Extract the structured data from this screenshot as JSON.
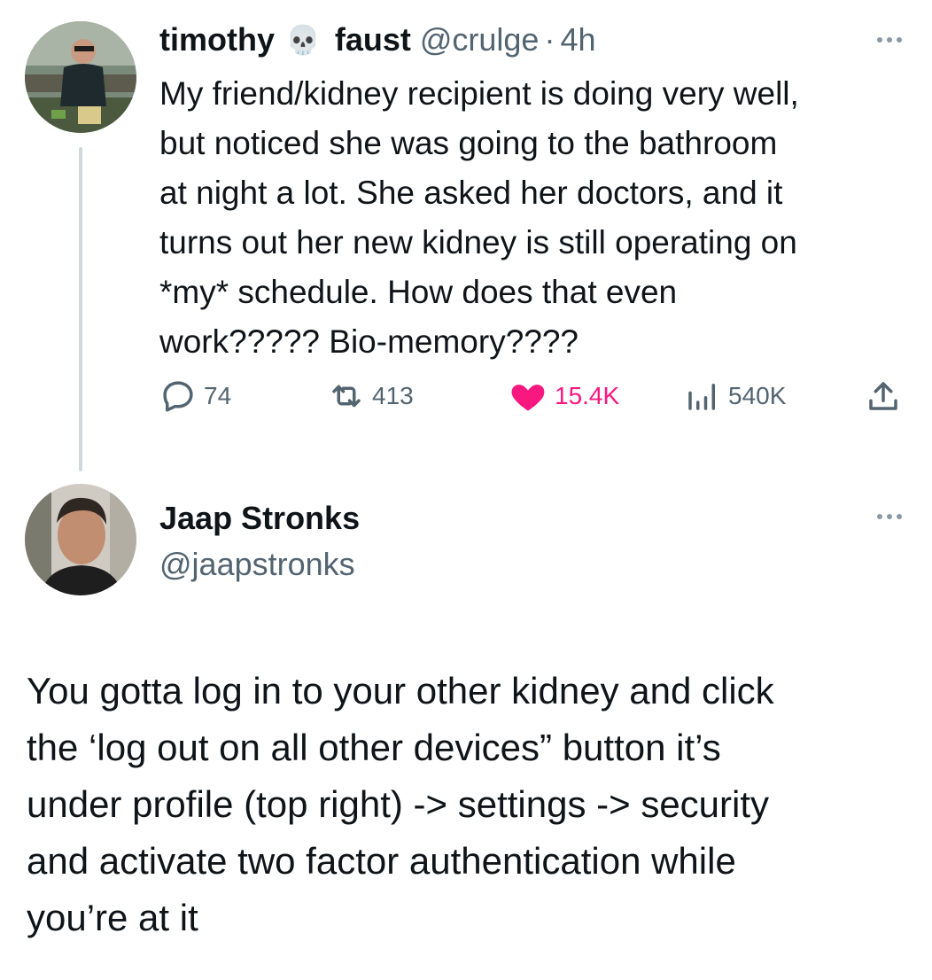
{
  "tweet": {
    "author_name_first": "timothy",
    "author_emoji": "💀",
    "author_name_last": "faust",
    "handle": "@crulge",
    "separator": "·",
    "time": "4h",
    "text": "My friend/kidney recipient is doing very well,\nbut noticed she was going to the bathroom\nat night a lot. She asked her doctors, and it\nturns out her new kidney is still operating on\n*my* schedule. How does that even\nwork????? Bio-memory????",
    "stats": {
      "replies": "74",
      "retweets": "413",
      "likes": "15.4K",
      "views": "540K"
    }
  },
  "reply": {
    "author_name": "Jaap Stronks",
    "handle": "@jaapstronks",
    "text": "You gotta log in to your other kidney and click\nthe ‘log out on all other devices” button it’s\nunder profile (top right) -> settings -> security\nand activate two factor authentication while\nyou’re at it"
  },
  "colors": {
    "text": "#0f1419",
    "secondary": "#536471",
    "like": "#f91880",
    "thread_line": "#cfd9de"
  },
  "icons": [
    "reply-icon",
    "retweet-icon",
    "heart-icon",
    "views-icon",
    "share-icon",
    "more-icon"
  ]
}
